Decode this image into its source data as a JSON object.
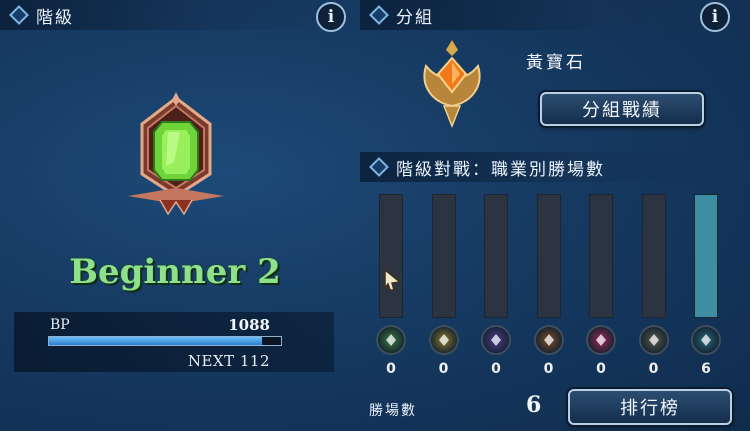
{
  "left": {
    "header": "階級",
    "rank_name": "Beginner 2",
    "bp_label": "BP",
    "bp_value": "1088",
    "bp_progress": 0.92,
    "next_label": "NEXT 112"
  },
  "right": {
    "header": "分組",
    "group_name": "黃寶石",
    "group_record_button": "分組戰績",
    "subheader": "階級對戰：職業別勝場數",
    "classes": [
      {
        "icon": "leaf-icon",
        "color": "#3c7a3c",
        "count": "0",
        "fill": 0
      },
      {
        "icon": "crown-icon",
        "color": "#8a7a2a",
        "count": "0",
        "fill": 0
      },
      {
        "icon": "magic-circle-icon",
        "color": "#4a3d8c",
        "count": "0",
        "fill": 0
      },
      {
        "icon": "beast-icon",
        "color": "#7a4a2a",
        "count": "0",
        "fill": 0
      },
      {
        "icon": "demon-icon",
        "color": "#9c2a5a",
        "count": "0",
        "fill": 0
      },
      {
        "icon": "claw-icon",
        "color": "#5a5a4a",
        "count": "0",
        "fill": 0
      },
      {
        "icon": "spirit-icon",
        "color": "#2a6a7a",
        "count": "6",
        "fill": 1
      }
    ],
    "wins_label": "勝場數",
    "wins_value": "6",
    "leaderboard_button": "排行榜"
  }
}
